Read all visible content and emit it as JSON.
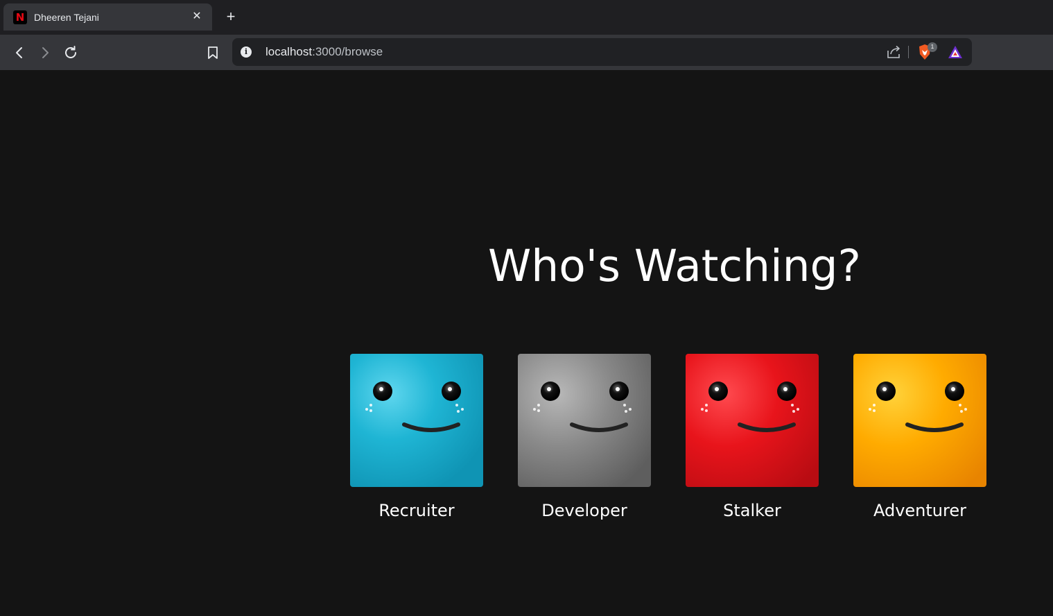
{
  "browser": {
    "tab_title": "Dheeren Tejani",
    "tab_favicon_letter": "N",
    "close_icon": "close-icon",
    "new_tab_icon": "plus-icon",
    "url_host": "localhost",
    "url_path": ":3000/browse",
    "brave_badge_count": "1"
  },
  "page": {
    "heading": "Who's Watching?",
    "profiles": [
      {
        "name": "Recruiter",
        "color": "#1fb5d4"
      },
      {
        "name": "Developer",
        "color": "#8a8a8a"
      },
      {
        "name": "Stalker",
        "color": "#e8141b"
      },
      {
        "name": "Adventurer",
        "color": "#ffab00"
      }
    ]
  },
  "colors": {
    "background": "#141414",
    "toolbar": "#35363a",
    "tabbar": "#1f1f22"
  }
}
